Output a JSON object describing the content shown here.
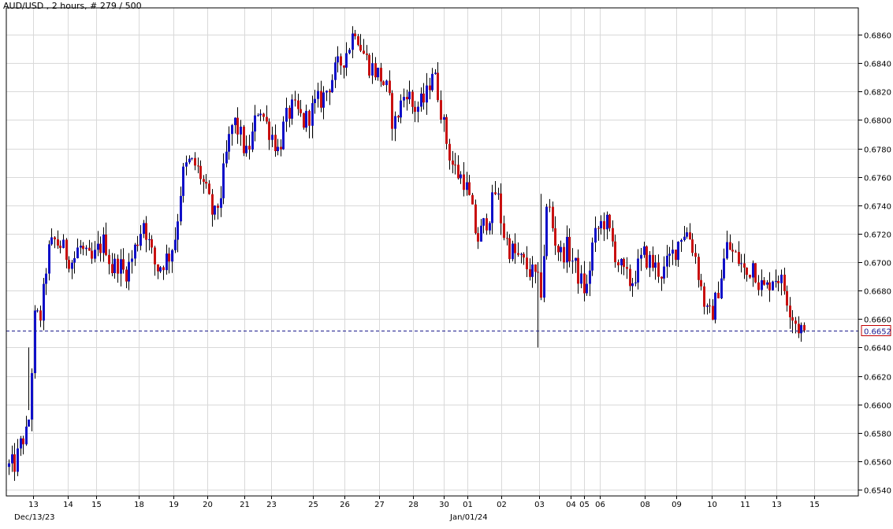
{
  "chart_data": {
    "type": "candlestick",
    "title": "AUD/USD , 2 hours, # 279 / 500",
    "ylim": [
      0.6535,
      0.6875
    ],
    "y_ticks": [
      "0.6860",
      "0.6840",
      "0.6820",
      "0.6800",
      "0.6780",
      "0.6760",
      "0.6740",
      "0.6720",
      "0.6700",
      "0.6680",
      "0.6660",
      "0.6640",
      "0.6620",
      "0.6600",
      "0.6580",
      "0.6560",
      "0.6540"
    ],
    "x_ticks": [
      "13",
      "14",
      "15",
      "18",
      "19",
      "20",
      "21",
      "23",
      "25",
      "26",
      "27",
      "28",
      "30",
      "01",
      "02",
      "03",
      "04",
      "05",
      "06",
      "08",
      "09",
      "10",
      "11",
      "13",
      "15"
    ],
    "date_labels": [
      "Dec/13/23",
      "Jan/01/24"
    ],
    "current_price": "0.6652",
    "grid": true,
    "colors": {
      "up": "#1010c8",
      "down": "#c81010",
      "wick": "#000000",
      "grid": "#d9d9d9",
      "current_line": "#1a1a8c"
    },
    "anchors": [
      0.6556,
      0.6558,
      0.6575,
      0.658,
      0.666,
      0.6662,
      0.6705,
      0.6715,
      0.6712,
      0.6705,
      0.67,
      0.6712,
      0.6703,
      0.67,
      0.671,
      0.6715,
      0.6695,
      0.67,
      0.6692,
      0.67,
      0.6715,
      0.673,
      0.671,
      0.6695,
      0.67,
      0.6705,
      0.672,
      0.676,
      0.677,
      0.6768,
      0.676,
      0.6745,
      0.673,
      0.6748,
      0.6778,
      0.68,
      0.679,
      0.6775,
      0.679,
      0.6812,
      0.6798,
      0.679,
      0.6778,
      0.6798,
      0.6808,
      0.6805,
      0.6798,
      0.6805,
      0.6812,
      0.6816,
      0.6826,
      0.6835,
      0.6842,
      0.6852,
      0.6866,
      0.685,
      0.684,
      0.6835,
      0.683,
      0.682,
      0.6795,
      0.681,
      0.6822,
      0.6808,
      0.681,
      0.6815,
      0.6836,
      0.6818,
      0.679,
      0.677,
      0.6762,
      0.6758,
      0.674,
      0.6715,
      0.6725,
      0.6735,
      0.6752,
      0.6722,
      0.671,
      0.6705,
      0.67,
      0.6695,
      0.669,
      0.668,
      0.6745,
      0.6718,
      0.6705,
      0.671,
      0.67,
      0.6688,
      0.6678,
      0.6712,
      0.6725,
      0.673,
      0.6715,
      0.67,
      0.669,
      0.6685,
      0.6695,
      0.6705,
      0.67,
      0.6695,
      0.6692,
      0.6702,
      0.671,
      0.6722,
      0.672,
      0.6705,
      0.668,
      0.666,
      0.6668,
      0.669,
      0.6712,
      0.6705,
      0.67,
      0.669,
      0.67,
      0.6685,
      0.668,
      0.669,
      0.669,
      0.668,
      0.6665,
      0.6655,
      0.6652
    ]
  }
}
